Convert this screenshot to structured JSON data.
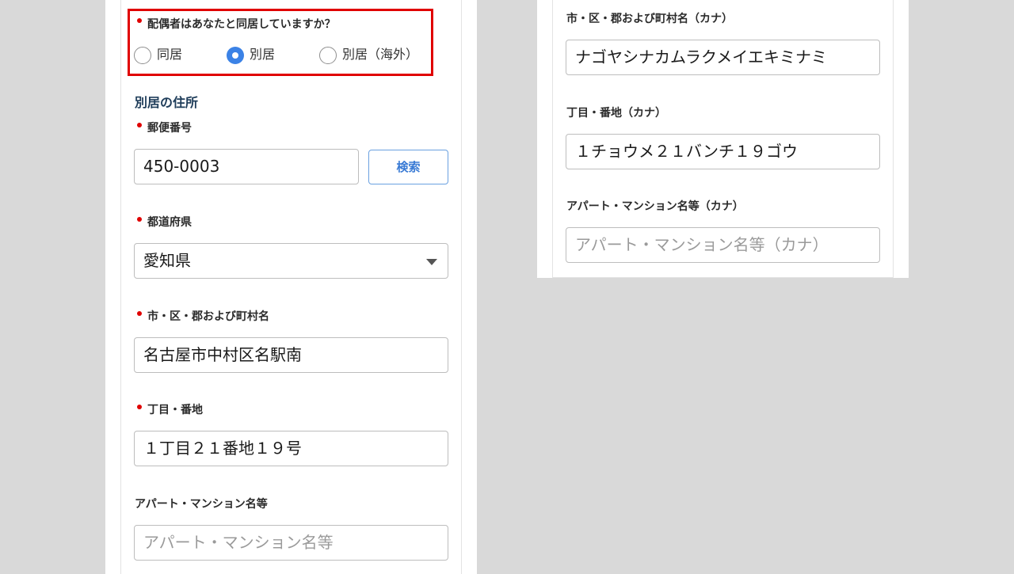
{
  "spouse_question": {
    "label": "配偶者はあなたと同居していますか？",
    "options": [
      {
        "label": "同居",
        "checked": false
      },
      {
        "label": "別居",
        "checked": true
      },
      {
        "label": "別居（海外）",
        "checked": false
      }
    ]
  },
  "separate_address": {
    "section_title": "別居の住所",
    "postal_code": {
      "label": "郵便番号",
      "value": "450-0003"
    },
    "search_button": "検索",
    "prefecture": {
      "label": "都道府県",
      "value": "愛知県"
    },
    "city": {
      "label": "市・区・郡および町村名",
      "value": "名古屋市中村区名駅南"
    },
    "block": {
      "label": "丁目・番地",
      "value": "１丁目２１番地１９号"
    },
    "building": {
      "label": "アパート・マンション名等",
      "placeholder": "アパート・マンション名等"
    }
  },
  "kana": {
    "city": {
      "label": "市・区・郡および町村名（カナ）",
      "value": "ナゴヤシナカムラクメイエキミナミ"
    },
    "block": {
      "label": "丁目・番地（カナ）",
      "value": "１チョウメ２１バンチ１９ゴウ"
    },
    "building": {
      "label": "アパート・マンション名等（カナ）",
      "placeholder": "アパート・マンション名等（カナ）"
    }
  },
  "colors": {
    "required_dot": "#e00000",
    "highlight": "#e00000",
    "accent": "#3b82e6"
  }
}
